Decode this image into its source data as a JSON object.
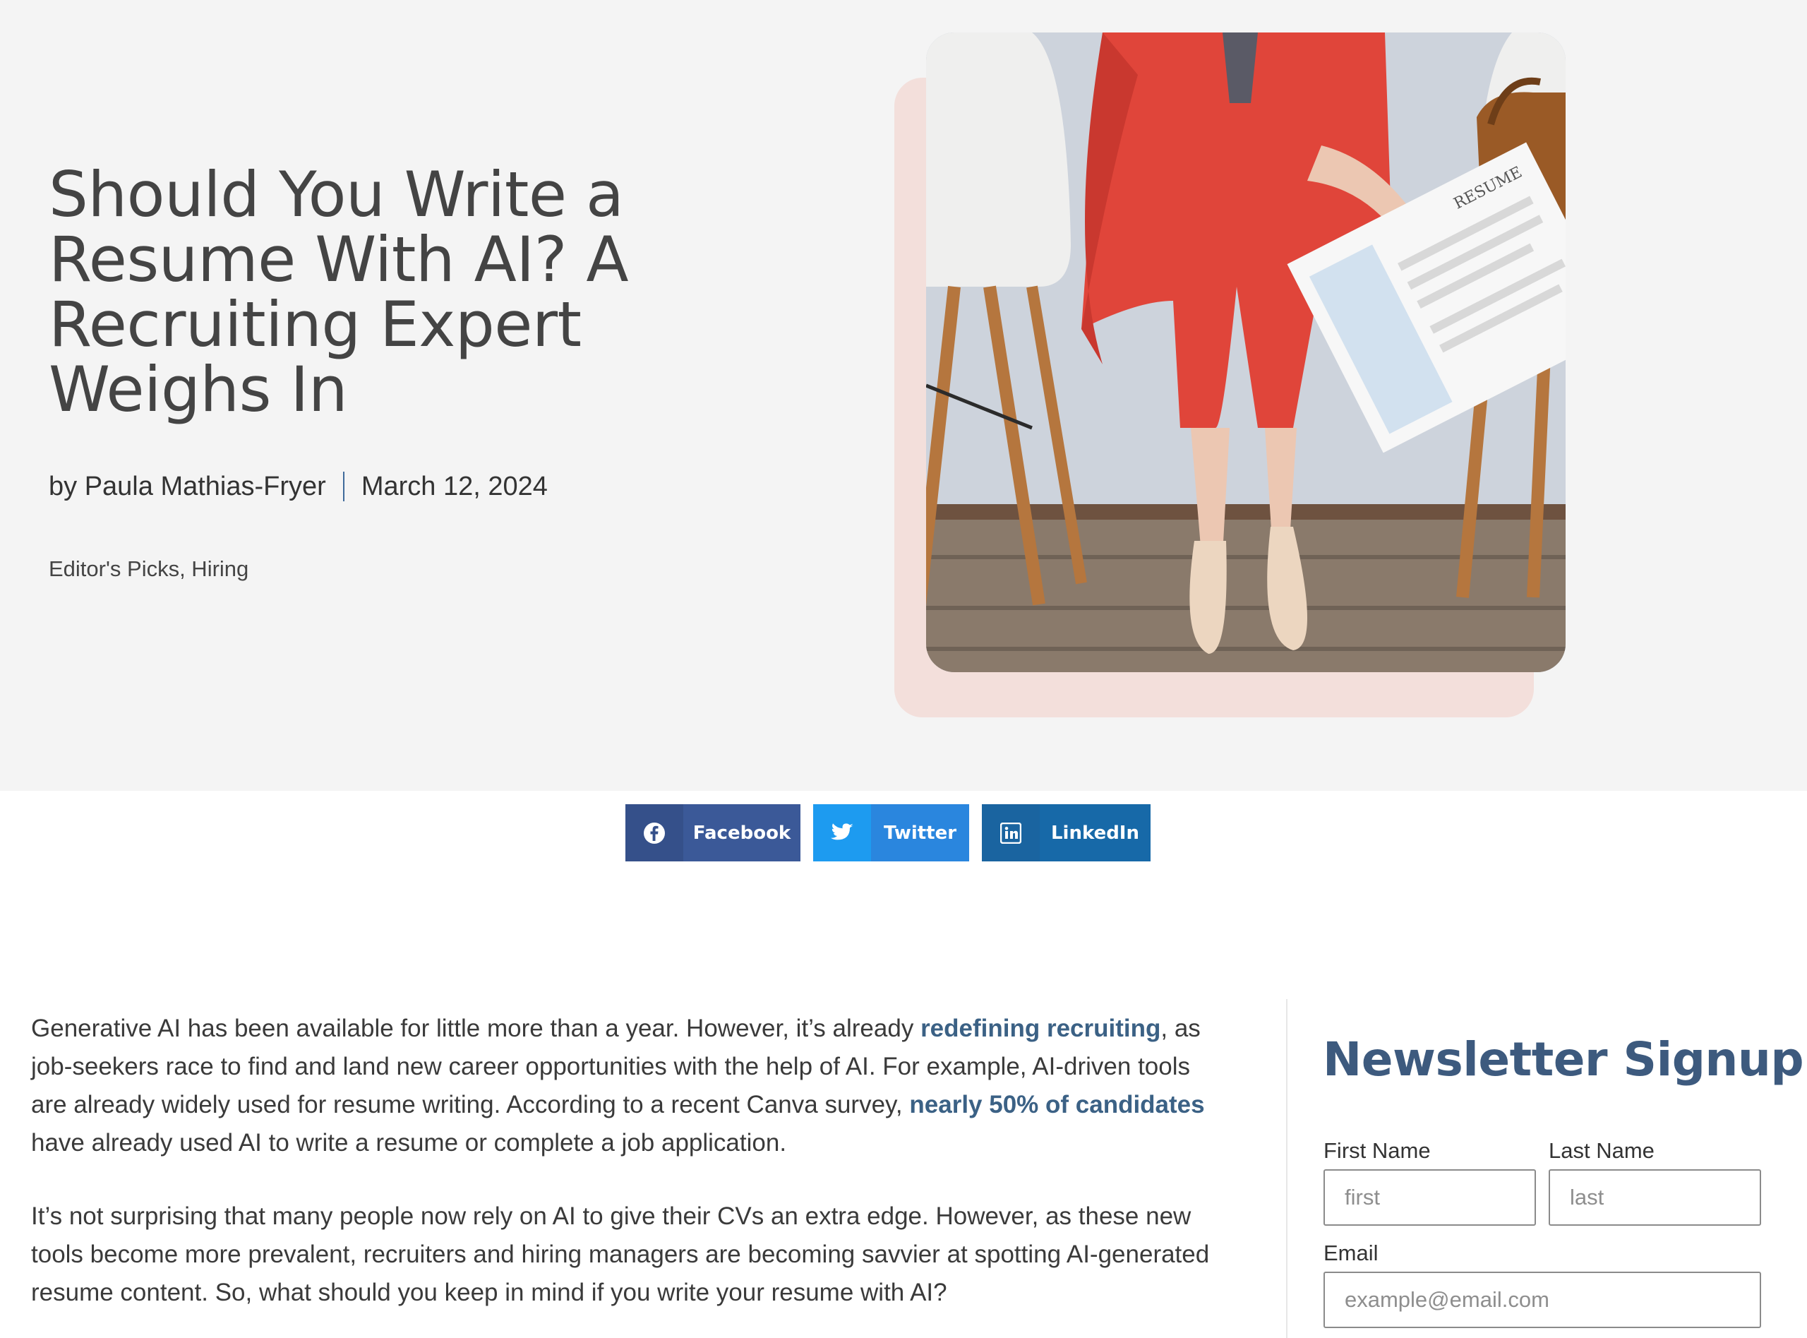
{
  "article": {
    "title": "Should You Write a Resume With AI? A Recruiting Expert Weighs In",
    "author": "by Paula Mathias-Fryer",
    "date": "March 12, 2024",
    "categories": "Editor's Picks, Hiring",
    "paragraph1": {
      "part1": "Generative AI has been available for little more than a year. However, it’s already ",
      "link1": "redefining recruiting",
      "part2": ", as job-seekers race to find and land new career opportunities with the help of AI. For example, AI-driven tools are already widely used for resume writing. According to a recent Canva survey, ",
      "link2": "nearly 50% of candidates",
      "part3": " have already used AI to write a resume or complete a job application."
    },
    "paragraph2": "It’s not surprising that many people now rely on AI to give their CVs an extra edge. However, as these new tools become more prevalent, recruiters and hiring managers are becoming savvier at spotting AI-generated resume content. So, what should you keep in mind if you write your resume with AI?",
    "image_text": "RESUME"
  },
  "share": {
    "facebook": {
      "label": "Facebook",
      "icon": "facebook-icon"
    },
    "twitter": {
      "label": "Twitter",
      "icon": "twitter-icon"
    },
    "linkedin": {
      "label": "LinkedIn",
      "icon": "linkedin-icon"
    }
  },
  "newsletter": {
    "title": "Newsletter Signup",
    "first_name_label": "First Name",
    "first_name_placeholder": "first",
    "last_name_label": "Last Name",
    "last_name_placeholder": "last",
    "email_label": "Email",
    "email_placeholder": "example@email.com"
  },
  "colors": {
    "hero_bg": "#f4f4f4",
    "accent": "#3b6185",
    "facebook": "#3b5998",
    "twitter": "#2a86de",
    "linkedin": "#1769a8"
  }
}
